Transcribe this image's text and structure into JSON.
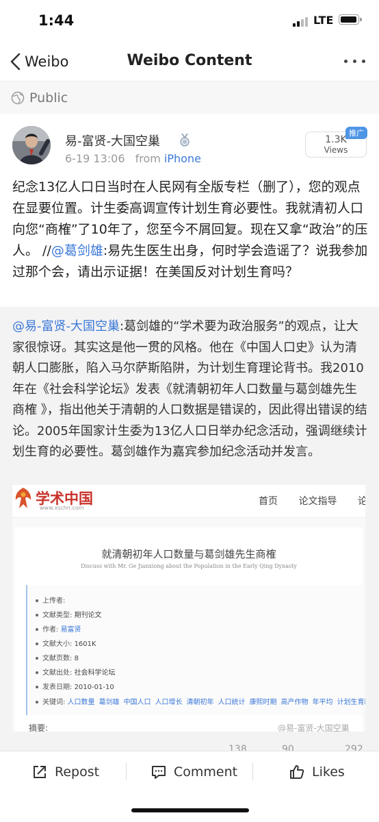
{
  "status_bar": {
    "time": "1:44",
    "network": "LTE"
  },
  "nav": {
    "back_label": "Weibo",
    "title": "Weibo Content",
    "more_icon": "ellipsis-icon"
  },
  "visibility": {
    "label": "Public",
    "icon": "globe-icon"
  },
  "post": {
    "author": "易-富贤-大国空巢",
    "timestamp": "6-19 13:06",
    "source_prefix": "from",
    "source": "iPhone",
    "views_count": "1.3K",
    "views_label": "Views",
    "promo_tag": "推广",
    "text_before_mention": "纪念13亿人口日当时在人民网有全版专栏（删了），您的观点在显要位置。计生委高调宣传计划生育必要性。我就清初人口向您“商榷”了10年了，您至今不屑回复。现在又拿“政治”的压人。 //",
    "mention": "@葛剑雄",
    "text_after_mention": ":易先生医生出身，何时学会造谣了？说我参加过那个会，请出示证据！在美国反对计划生育吗？"
  },
  "quoted": {
    "mention": "@易-富贤-大国空巢",
    "text": ":葛剑雄的“学术要为政治服务”的观点，让大家很惊讶。其实这是他一贯的风格。他在《中国人口史》认为清朝人口膨胀，陷入马尔萨斯陷阱，为计划生育理论背书。我2010年在《社会科学论坛》发表《就清朝初年人口数量与葛剑雄先生商榷 》，指出他关于清朝的人口数据是错误的，因此得出错误的结论。2005年国家计生委为13亿人口日举办纪念活动，强调继续计划生育的必要性。葛剑雄作为嘉宾参加纪念活动并发言。",
    "image": {
      "site_name": "学术中国",
      "site_url": "www.xschn.com",
      "nav": [
        "首页",
        "论文指导",
        "论文发表"
      ],
      "paper_title": "就清朝初年人口数量与葛剑雄先生商榷",
      "paper_subtitle": "Discuss with Mr. Ge Jianxiong about the Population in the Early Qing Dynasty",
      "fields": [
        {
          "label": "上传者:",
          "value": ""
        },
        {
          "label": "文献类型:",
          "value": "期刊论文"
        },
        {
          "label": "作者:",
          "value": "易富贤"
        },
        {
          "label": "文献大小:",
          "value": "1601K"
        },
        {
          "label": "文献页数:",
          "value": "8"
        },
        {
          "label": "文献出处:",
          "value": "社会科学论坛"
        },
        {
          "label": "发表日期:",
          "value": "2010-01-10"
        }
      ],
      "keywords_label": "关键词:",
      "keywords": [
        "人口数量",
        "葛剑雄",
        "中国人口",
        "人口增长",
        "清朝初年",
        "人口统计",
        "康熙时期",
        "高产作物",
        "年平均",
        "计划生育政策"
      ],
      "abstract_label": "摘要:",
      "watermark": "@易-富贤-大国空巢"
    },
    "counts": {
      "reposts": "138",
      "comments": "90",
      "likes": "292"
    }
  },
  "actions": {
    "repost": "Repost",
    "comment": "Comment",
    "likes": "Likes"
  }
}
